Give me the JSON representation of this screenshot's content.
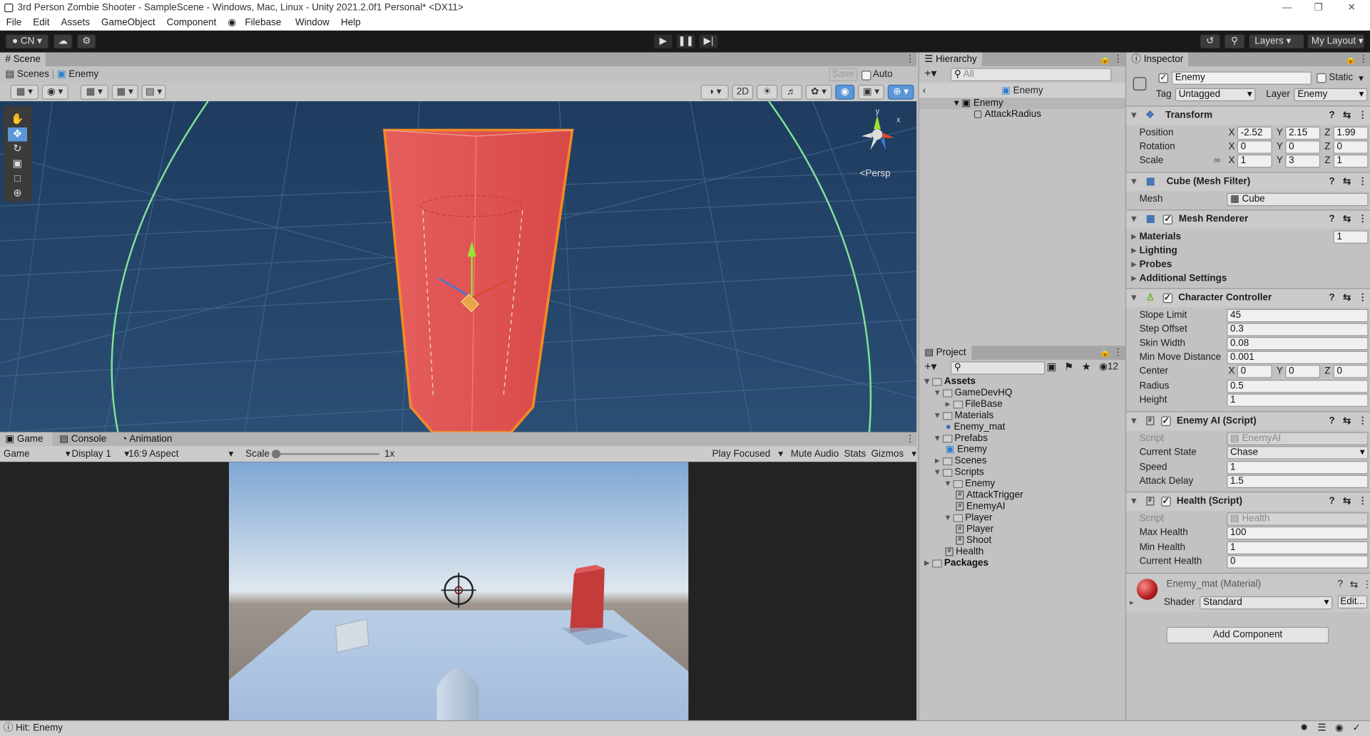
{
  "window": {
    "title": "3rd Person Zombie Shooter - SampleScene - Windows, Mac, Linux - Unity 2021.2.0f1 Personal* <DX11>"
  },
  "menu": [
    "File",
    "Edit",
    "Assets",
    "GameObject",
    "Component",
    "Filebase",
    "Window",
    "Help"
  ],
  "toolbar": {
    "account": "CN",
    "layers": "Layers",
    "layout": "My Layout"
  },
  "scene": {
    "tab": "Scene",
    "breadcrumb_root": "Scenes",
    "breadcrumb_object": "Enemy",
    "save": "Save",
    "auto_save": "Auto Save",
    "mode_2d": "2D",
    "persp": "Persp",
    "gizmo_y": "y",
    "gizmo_x": "x"
  },
  "game": {
    "tabs": [
      "Game",
      "Console",
      "Animation"
    ],
    "display_mode": "Game",
    "display": "Display 1",
    "aspect": "16:9 Aspect",
    "scale_label": "Scale",
    "scale_value": "1x",
    "play_focused": "Play Focused",
    "mute": "Mute Audio",
    "stats": "Stats",
    "gizmos": "Gizmos"
  },
  "hierarchy": {
    "tab": "Hierarchy",
    "search": "All",
    "scene_object": "Enemy",
    "items": [
      {
        "label": "Enemy"
      },
      {
        "label": "AttackRadius"
      }
    ]
  },
  "project": {
    "tab": "Project",
    "hidden_count": "12",
    "tree": [
      {
        "label": "Assets",
        "type": "folder",
        "depth": 0,
        "bold": true
      },
      {
        "label": "GameDevHQ",
        "type": "folder",
        "depth": 1
      },
      {
        "label": "FileBase",
        "type": "folder",
        "depth": 2
      },
      {
        "label": "Materials",
        "type": "folder",
        "depth": 1
      },
      {
        "label": "Enemy_mat",
        "type": "material",
        "depth": 2
      },
      {
        "label": "Prefabs",
        "type": "folder",
        "depth": 1
      },
      {
        "label": "Enemy",
        "type": "prefab",
        "depth": 2
      },
      {
        "label": "Scenes",
        "type": "folder",
        "depth": 1
      },
      {
        "label": "Scripts",
        "type": "folder",
        "depth": 1
      },
      {
        "label": "Enemy",
        "type": "folder",
        "depth": 2
      },
      {
        "label": "AttackTrigger",
        "type": "script",
        "depth": 3
      },
      {
        "label": "EnemyAI",
        "type": "script",
        "depth": 3
      },
      {
        "label": "Player",
        "type": "folder",
        "depth": 2
      },
      {
        "label": "Player",
        "type": "script",
        "depth": 3
      },
      {
        "label": "Shoot",
        "type": "script",
        "depth": 3
      },
      {
        "label": "Health",
        "type": "script",
        "depth": 2
      },
      {
        "label": "Packages",
        "type": "folder",
        "depth": 0,
        "bold": true
      }
    ]
  },
  "inspector": {
    "tab": "Inspector",
    "object_name": "Enemy",
    "static": "Static",
    "tag_label": "Tag",
    "tag": "Untagged",
    "layer_label": "Layer",
    "layer": "Enemy",
    "transform": {
      "title": "Transform",
      "position": {
        "label": "Position",
        "x": "-2.52",
        "y": "2.15",
        "z": "1.99"
      },
      "rotation": {
        "label": "Rotation",
        "x": "0",
        "y": "0",
        "z": "0"
      },
      "scale": {
        "label": "Scale",
        "x": "1",
        "y": "3",
        "z": "1"
      }
    },
    "mesh_filter": {
      "title": "Cube (Mesh Filter)",
      "mesh_label": "Mesh",
      "mesh": "Cube"
    },
    "mesh_renderer": {
      "title": "Mesh Renderer",
      "materials": "Materials",
      "materials_count": "1",
      "lighting": "Lighting",
      "probes": "Probes",
      "additional": "Additional Settings"
    },
    "character_controller": {
      "title": "Character Controller",
      "fields": [
        {
          "label": "Slope Limit",
          "value": "45"
        },
        {
          "label": "Step Offset",
          "value": "0.3"
        },
        {
          "label": "Skin Width",
          "value": "0.08"
        },
        {
          "label": "Min Move Distance",
          "value": "0.001"
        }
      ],
      "center_label": "Center",
      "center": {
        "x": "0",
        "y": "0",
        "z": "0"
      },
      "radius_label": "Radius",
      "radius": "0.5",
      "height_label": "Height",
      "height": "1"
    },
    "enemy_ai": {
      "title": "Enemy AI (Script)",
      "script_label": "Script",
      "script": "EnemyAI",
      "state_label": "Current State",
      "state": "Chase",
      "speed_label": "Speed",
      "speed": "1",
      "delay_label": "Attack Delay",
      "delay": "1.5"
    },
    "health": {
      "title": "Health (Script)",
      "script_label": "Script",
      "script": "Health",
      "max_label": "Max Health",
      "max": "100",
      "min_label": "Min Health",
      "min": "1",
      "current_label": "Current Health",
      "current": "0"
    },
    "material": {
      "title": "Enemy_mat (Material)",
      "shader_label": "Shader",
      "shader": "Standard",
      "edit": "Edit..."
    },
    "add_component": "Add Component"
  },
  "status": {
    "text": "Hit: Enemy"
  },
  "colors": {
    "scene_bg": "#243f5e",
    "enemy_red": "#d9534f",
    "selection_orange": "#f08a24",
    "game_sky_top": "#7fa6d4"
  }
}
